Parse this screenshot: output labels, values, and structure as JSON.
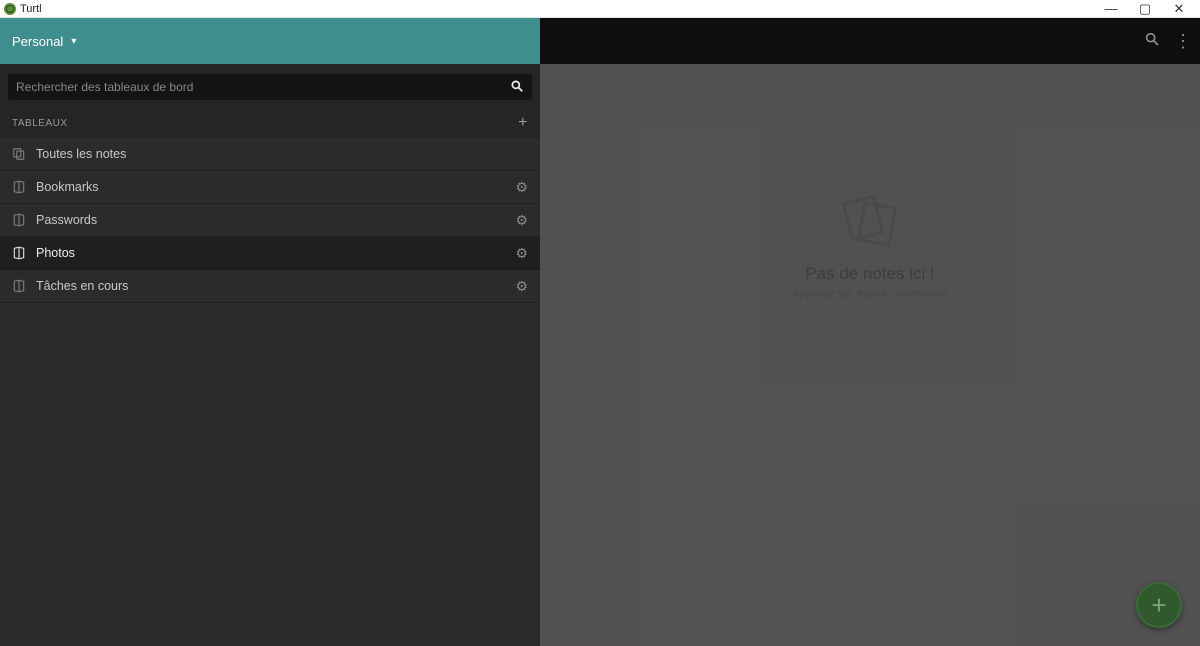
{
  "window": {
    "title": "Turtl",
    "min": "—",
    "max": "▢",
    "close": "✕"
  },
  "space": {
    "name": "Personal"
  },
  "search": {
    "placeholder": "Rechercher des tableaux de bord"
  },
  "section": {
    "label": "TABLEAUX"
  },
  "boards": {
    "all_notes": "Toutes les notes",
    "items": [
      {
        "label": "Bookmarks"
      },
      {
        "label": "Passwords"
      },
      {
        "label": "Photos"
      },
      {
        "label": "Tâches en cours"
      }
    ],
    "active_index": 2
  },
  "empty": {
    "heading": "Pas de notes ici !",
    "sub_pre": "Appuyez sur ",
    "sub_plus": "+",
    "sub_post": " pour commencer"
  },
  "icons": {
    "chevron_down": "▾",
    "search": "🔍",
    "plus": "+",
    "gear": "⚙",
    "more": "⋮"
  }
}
